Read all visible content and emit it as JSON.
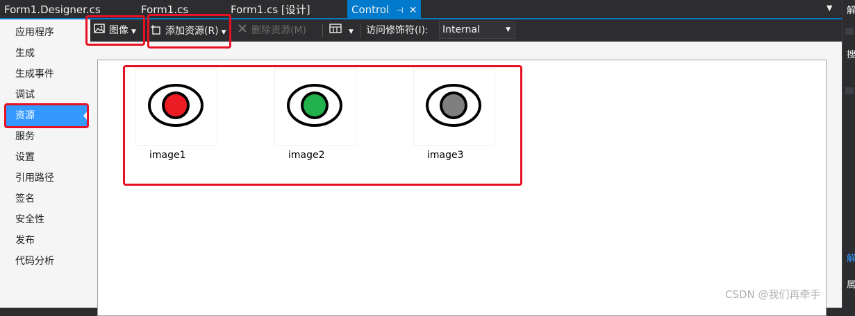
{
  "tabs": [
    {
      "label": "Form1.Designer.cs"
    },
    {
      "label": "Form1.cs"
    },
    {
      "label": "Form1.cs [设计]"
    },
    {
      "label": "Control",
      "pin": "⊣",
      "close": "✕"
    }
  ],
  "tab_overflow": "▼",
  "right_panel": {
    "glyph_top": "解",
    "glyph_mid": "搜",
    "glyph_solution": "解",
    "glyph_bottom": "属"
  },
  "sidebar": {
    "items": [
      {
        "label": "应用程序"
      },
      {
        "label": "生成"
      },
      {
        "label": "生成事件"
      },
      {
        "label": "调试"
      },
      {
        "label": "资源"
      },
      {
        "label": "服务"
      },
      {
        "label": "设置"
      },
      {
        "label": "引用路径"
      },
      {
        "label": "签名"
      },
      {
        "label": "安全性"
      },
      {
        "label": "发布"
      },
      {
        "label": "代码分析"
      }
    ]
  },
  "toolbar": {
    "images_label": "图像",
    "add_resource_label": "添加资源(R)",
    "remove_resource_label": "删除资源(M)",
    "access_modifier_label": "访问修饰符(I):",
    "access_modifier_value": "Internal"
  },
  "resources": [
    {
      "name": "image1",
      "color": "#ed1c24"
    },
    {
      "name": "image2",
      "color": "#22b14c"
    },
    {
      "name": "image3",
      "color": "#7f7f7f"
    }
  ],
  "watermark": "CSDN @我们再牵手"
}
